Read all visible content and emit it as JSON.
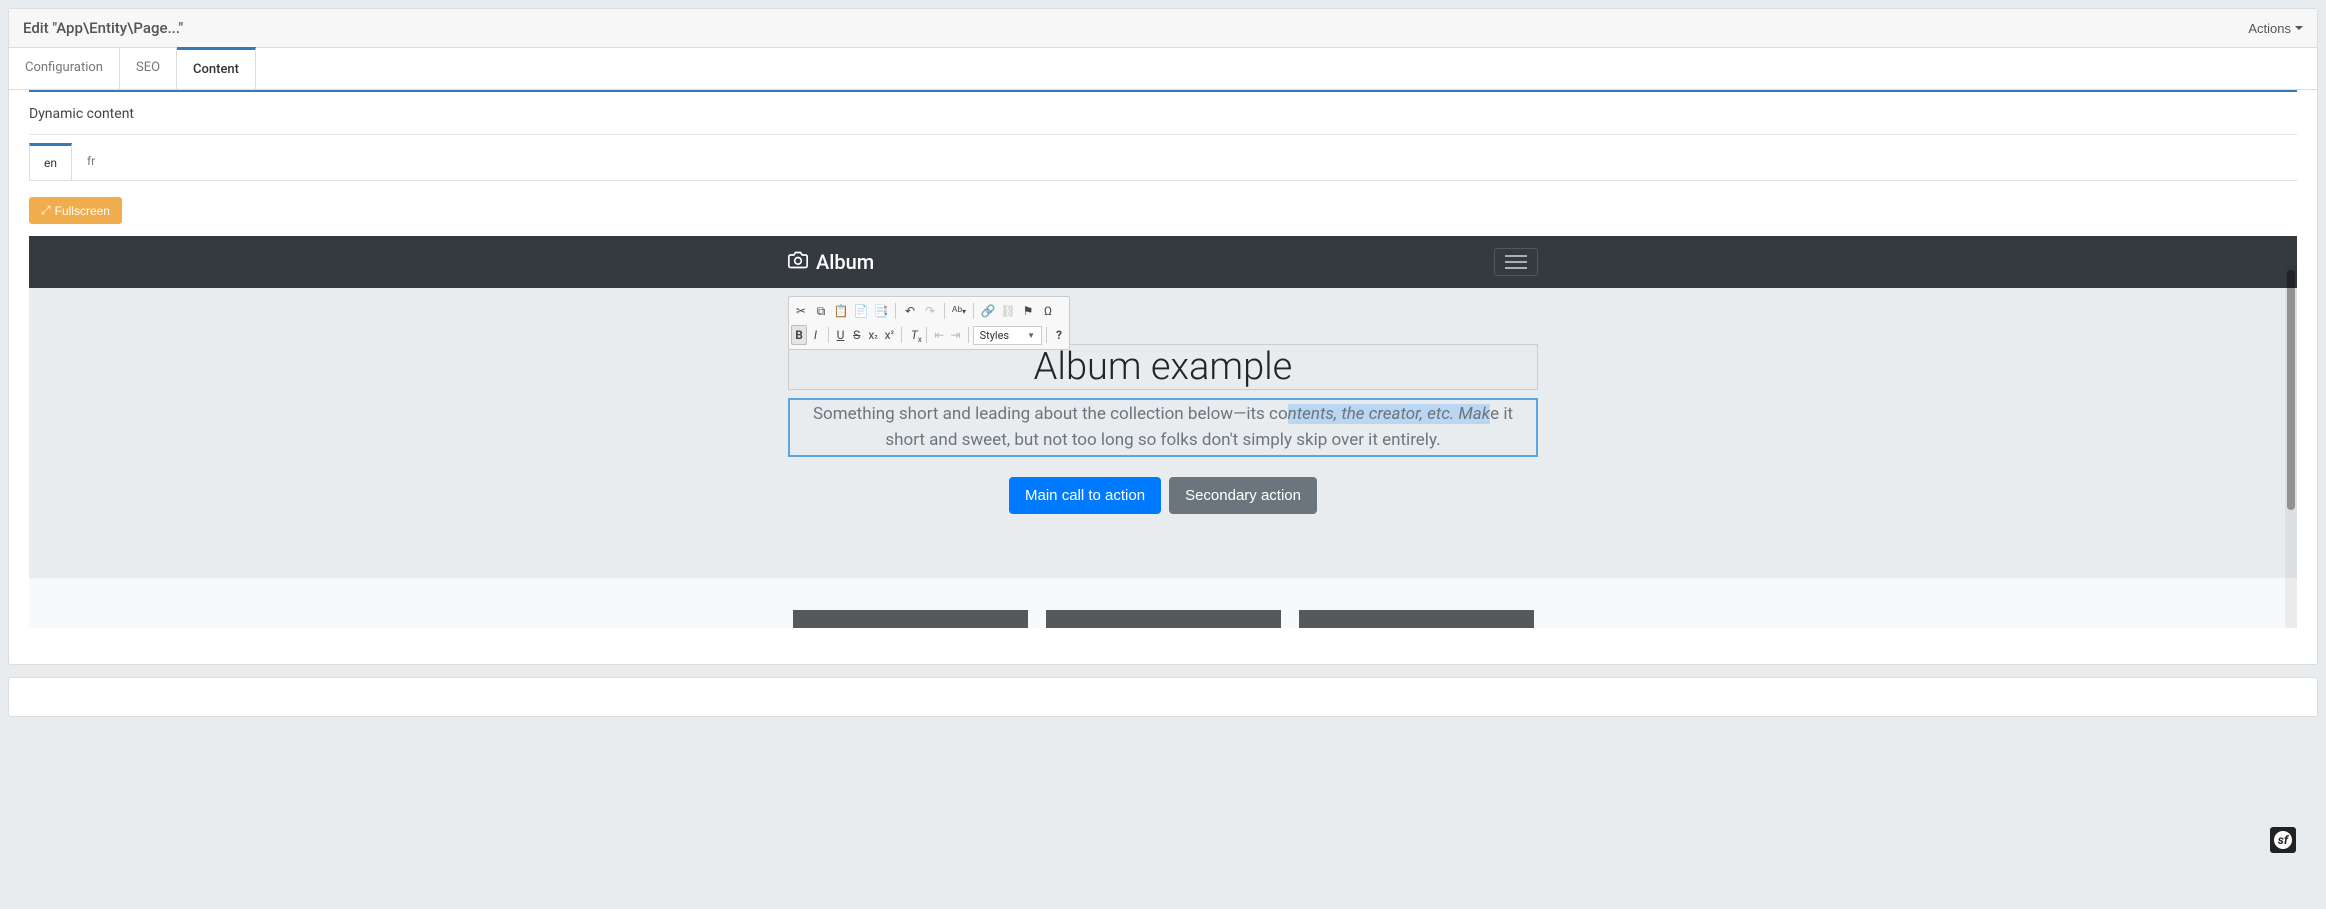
{
  "header": {
    "title": "Edit \"App\\Entity\\Page...\"",
    "actions_label": "Actions"
  },
  "tabs": {
    "configuration": "Configuration",
    "seo": "SEO",
    "content": "Content"
  },
  "section": {
    "dynamic_content": "Dynamic content"
  },
  "lang": {
    "en": "en",
    "fr": "fr"
  },
  "editor": {
    "fullscreen_label": "Fullscreen"
  },
  "preview": {
    "brand": "Album",
    "title": "Album example",
    "sub_before": "Something short and leading about the collection below—its co",
    "sub_selected": "ntents, the creator, etc. Mak",
    "sub_after": "e it short and sweet, but not too long so folks don't simply skip over it entirely.",
    "cta_primary": "Main call to action",
    "cta_secondary": "Secondary action"
  },
  "cke": {
    "styles_label": "Styles"
  }
}
